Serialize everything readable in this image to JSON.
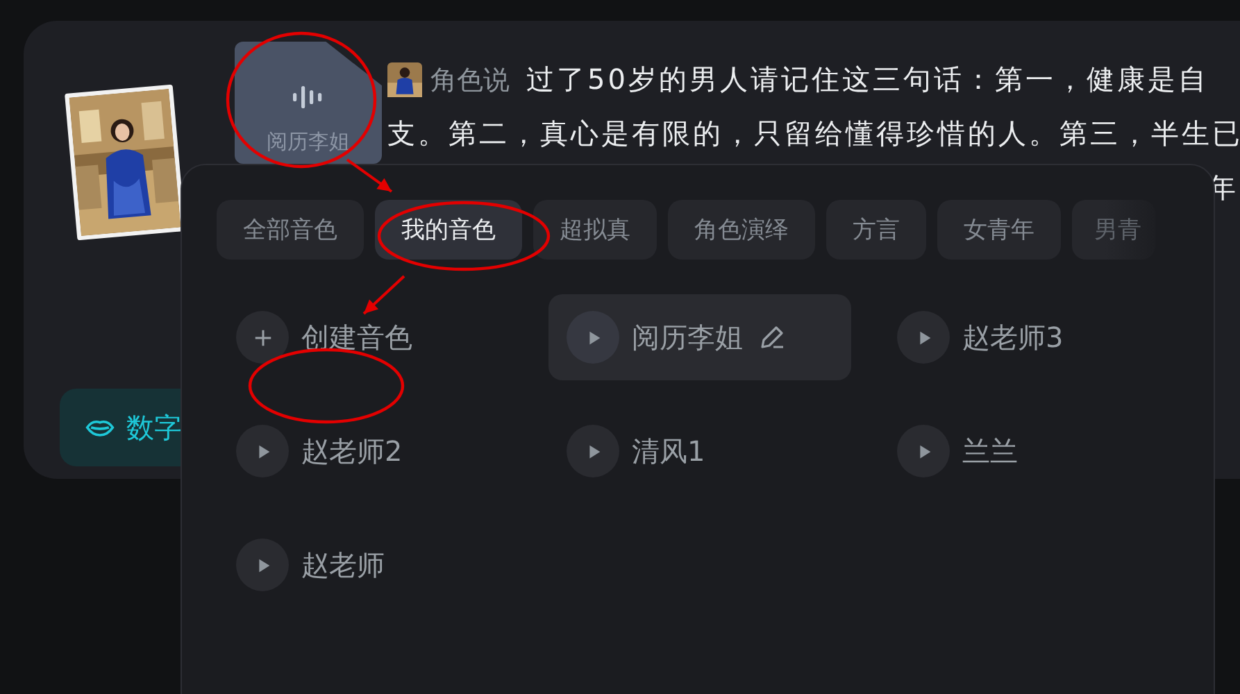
{
  "post": {
    "audio_file": {
      "name": "阅历李姐"
    },
    "speaker": "角色说",
    "lines": [
      "过了50岁的男人请记住这三句话：第一，健康是自",
      "支。第二，真心是有限的，只留给懂得珍惜的人。第三，半生已"
    ],
    "tail": "年",
    "button": "数字"
  },
  "voice_panel": {
    "tabs": [
      {
        "label": "全部音色",
        "selected": false
      },
      {
        "label": "我的音色",
        "selected": true
      },
      {
        "label": "超拟真",
        "selected": false
      },
      {
        "label": "角色演绎",
        "selected": false
      },
      {
        "label": "方言",
        "selected": false
      },
      {
        "label": "女青年",
        "selected": false
      },
      {
        "label": "男青",
        "selected": false
      }
    ],
    "voices": [
      {
        "kind": "create",
        "name": "创建音色",
        "selected": false
      },
      {
        "kind": "voice",
        "name": "阅历李姐",
        "selected": true,
        "editable": true
      },
      {
        "kind": "voice",
        "name": "赵老师3",
        "selected": false,
        "editable": false
      },
      {
        "kind": "voice",
        "name": "赵老师2",
        "selected": false,
        "editable": false
      },
      {
        "kind": "voice",
        "name": "清风1",
        "selected": false,
        "editable": false
      },
      {
        "kind": "voice",
        "name": "兰兰",
        "selected": false,
        "editable": false
      },
      {
        "kind": "voice",
        "name": "赵老师",
        "selected": false,
        "editable": false
      }
    ]
  },
  "annotations": [
    {
      "kind": "ellipse"
    },
    {
      "kind": "arrow"
    },
    {
      "kind": "ellipse"
    },
    {
      "kind": "arrow"
    },
    {
      "kind": "ellipse"
    }
  ]
}
